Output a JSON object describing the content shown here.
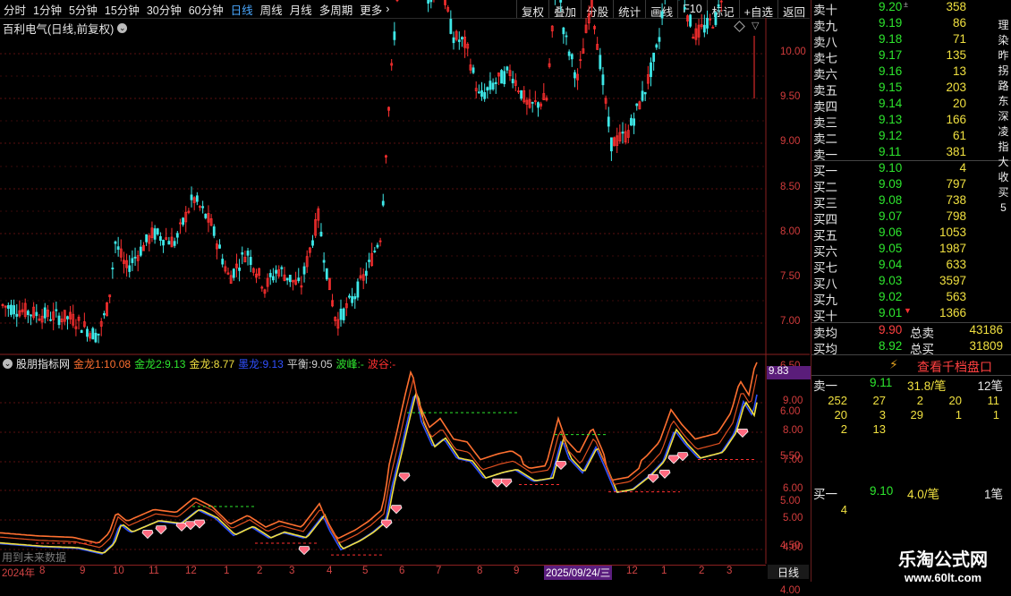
{
  "toolbar": {
    "periods": [
      "分时",
      "1分钟",
      "5分钟",
      "15分钟",
      "30分钟",
      "60分钟",
      "日线",
      "周线",
      "月线",
      "多周期",
      "更多"
    ],
    "active": "日线",
    "actions": [
      "复权",
      "叠加",
      "分股",
      "统计",
      "画线",
      "F10",
      "标记",
      "+自选",
      "返回"
    ]
  },
  "title": "百利电气(日线,前复权)",
  "indicator": {
    "name": "股朋指标网",
    "items": [
      {
        "label": "金龙1:",
        "value": "10.08",
        "color": "#ff7030"
      },
      {
        "label": "金龙2:",
        "value": "9.13",
        "color": "#2ee62e"
      },
      {
        "label": "金龙:",
        "value": "8.77",
        "color": "#f0e040"
      },
      {
        "label": "墨龙:",
        "value": "9.13",
        "color": "#3050ff"
      },
      {
        "label": "平衡:",
        "value": "9.05",
        "color": "#cfcfcf"
      },
      {
        "label": "波峰:",
        "value": "-",
        "color": "#2ee62e"
      },
      {
        "label": "波谷:",
        "value": "-",
        "color": "#ff3030"
      }
    ],
    "overlay_note": "用到未来数据"
  },
  "price_axis_main": [
    "10.00",
    "9.50",
    "9.00",
    "8.50",
    "8.00",
    "7.50",
    "7.00",
    "6.50",
    "6.00",
    "5.50",
    "5.00",
    "4.50",
    "4.00"
  ],
  "price_axis_ind": [
    "9.00",
    "8.00",
    "7.00",
    "6.00",
    "5.00",
    "4.00"
  ],
  "current_indicator_value": "9.83",
  "x_axis": {
    "year_label": "2024年",
    "months": [
      "8",
      "9",
      "10",
      "11",
      "12",
      "1",
      "2",
      "3",
      "4",
      "5",
      "6",
      "7",
      "8",
      "9",
      "10",
      "11",
      "12",
      "1",
      "2",
      "3"
    ],
    "cursor_date": "2025/09/24/三"
  },
  "period_label": "日线",
  "orderbook": {
    "asks": [
      {
        "label": "卖十",
        "price": "9.20",
        "vol": "358",
        "mark": "±"
      },
      {
        "label": "卖九",
        "price": "9.19",
        "vol": "86"
      },
      {
        "label": "卖八",
        "price": "9.18",
        "vol": "71"
      },
      {
        "label": "卖七",
        "price": "9.17",
        "vol": "135"
      },
      {
        "label": "卖六",
        "price": "9.16",
        "vol": "13"
      },
      {
        "label": "卖五",
        "price": "9.15",
        "vol": "203"
      },
      {
        "label": "卖四",
        "price": "9.14",
        "vol": "20"
      },
      {
        "label": "卖三",
        "price": "9.13",
        "vol": "166"
      },
      {
        "label": "卖二",
        "price": "9.12",
        "vol": "61"
      },
      {
        "label": "卖一",
        "price": "9.11",
        "vol": "381"
      }
    ],
    "bids": [
      {
        "label": "买一",
        "price": "9.10",
        "vol": "4"
      },
      {
        "label": "买二",
        "price": "9.09",
        "vol": "797"
      },
      {
        "label": "买三",
        "price": "9.08",
        "vol": "738"
      },
      {
        "label": "买四",
        "price": "9.07",
        "vol": "798"
      },
      {
        "label": "买五",
        "price": "9.06",
        "vol": "1053"
      },
      {
        "label": "买六",
        "price": "9.05",
        "vol": "1987"
      },
      {
        "label": "买七",
        "price": "9.04",
        "vol": "633"
      },
      {
        "label": "买八",
        "price": "9.03",
        "vol": "3597"
      },
      {
        "label": "买九",
        "price": "9.02",
        "vol": "563"
      },
      {
        "label": "买十",
        "price": "9.01",
        "vol": "1366",
        "mark": "▼"
      }
    ],
    "summary": [
      {
        "label": "卖均",
        "price": "9.90",
        "tlabel": "总卖",
        "total": "43186"
      },
      {
        "label": "买均",
        "price": "8.92",
        "tlabel": "总买",
        "total": "31809"
      }
    ]
  },
  "queue": {
    "button": "查看千档盘口",
    "ask": {
      "label": "卖一",
      "price": "9.11",
      "avg": "31.8/笔",
      "count": "12笔"
    },
    "ask_rows": [
      [
        "252",
        "27",
        "2",
        "20",
        "11"
      ],
      [
        "20",
        "3",
        "29",
        "1",
        "1"
      ],
      [
        "2",
        "13"
      ]
    ],
    "bid": {
      "label": "买一",
      "price": "9.10",
      "avg": "4.0/笔",
      "count": "1笔"
    },
    "bid_rows": [
      [
        "4"
      ]
    ]
  },
  "edge_chars": [
    "理",
    "染",
    "昨",
    "拐",
    "路",
    "东",
    "深",
    "凌",
    "指",
    "大",
    "收",
    "买",
    "5"
  ],
  "watermark": {
    "line1": "乐淘公式网",
    "line2": "www.60lt.com"
  },
  "colors": {
    "up": "#ff3030",
    "down": "#3ee8e8",
    "bg": "#000000",
    "grid": "#5a1010"
  }
}
